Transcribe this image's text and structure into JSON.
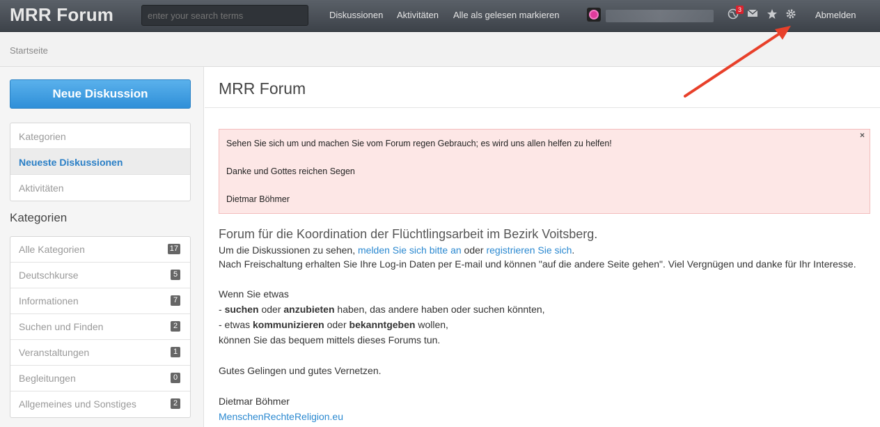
{
  "header": {
    "brand": "MRR Forum",
    "search_placeholder": "enter your search terms",
    "nav": [
      "Diskussionen",
      "Aktivitäten",
      "Alle als gelesen markieren"
    ],
    "notification_count": "3",
    "logout": "Abmelden",
    "icons": [
      "globe-icon",
      "envelope-icon",
      "star-icon",
      "gear-icon"
    ]
  },
  "breadcrumb": "Startseite",
  "sidebar": {
    "new_discussion": "Neue Diskussion",
    "nav": [
      "Kategorien",
      "Neueste Diskussionen",
      "Aktivitäten"
    ],
    "categories_heading": "Kategorien",
    "categories": [
      {
        "name": "Alle Kategorien",
        "count": "17"
      },
      {
        "name": "Deutschkurse",
        "count": "5"
      },
      {
        "name": "Informationen",
        "count": "7"
      },
      {
        "name": "Suchen und Finden",
        "count": "2"
      },
      {
        "name": "Veranstaltungen",
        "count": "1"
      },
      {
        "name": "Begleitungen",
        "count": "0"
      },
      {
        "name": "Allgemeines und Sonstiges",
        "count": "2"
      }
    ]
  },
  "main": {
    "title": "MRR Forum",
    "alert": {
      "line1": "Sehen Sie sich um und machen Sie vom Forum regen Gebrauch; es wird uns allen helfen zu helfen!",
      "line2": "Danke und Gottes reichen Segen",
      "line3": "Dietmar Böhmer",
      "close": "×"
    },
    "intro_heading": "Forum für die Koordination der Flüchtlingsarbeit im Bezirk Voitsberg.",
    "login_prefix": "Um die Diskussionen zu sehen, ",
    "login_link": "melden Sie sich bitte an",
    "login_mid": " oder ",
    "register_link": "registrieren Sie sich",
    "login_suffix": ".",
    "activation": "Nach Freischaltung erhalten Sie Ihre Log-in Daten per E-mail und können \"auf die andere Seite gehen\". Viel Vergnügen und danke für Ihr Interesse.",
    "if_you": "Wenn Sie etwas",
    "l1_pre": "- ",
    "l1_b1": "suchen",
    "l1_mid": " oder ",
    "l1_b2": "anzubieten",
    "l1_post": " haben, das andere haben oder suchen könnten,",
    "l2_pre": "- etwas ",
    "l2_b1": "kommunizieren",
    "l2_mid": " oder ",
    "l2_b2": "bekanntgeben",
    "l2_post": " wollen,",
    "l3": "können Sie das bequem mittels dieses Forums tun.",
    "wish": "Gutes Gelingen und gutes Vernetzen.",
    "signature": "Dietmar Böhmer",
    "site_link": "MenschenRechteReligion.eu"
  },
  "colors": {
    "accent": "#2f8fd8",
    "alert_bg": "#fde7e6",
    "arrow": "#e8402a"
  }
}
